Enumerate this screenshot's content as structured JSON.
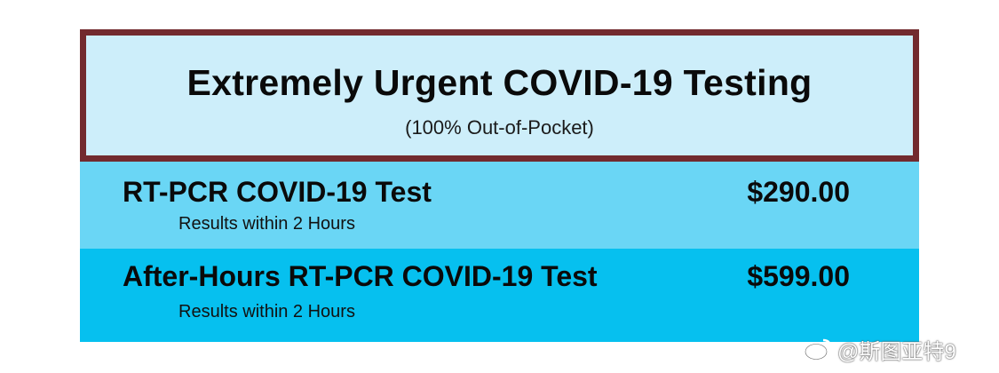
{
  "header": {
    "title": "Extremely Urgent COVID-19 Testing",
    "subtitle": "(100% Out-of-Pocket)"
  },
  "tests": [
    {
      "name": "RT-PCR COVID-19 Test",
      "note": "Results within 2 Hours",
      "price": "$290.00"
    },
    {
      "name": "After-Hours RT-PCR COVID-19 Test",
      "note": "Results within 2 Hours",
      "price": "$599.00"
    }
  ],
  "watermark": {
    "text": "@斯图亚特9",
    "icon": "weibo-icon"
  },
  "colors": {
    "border": "#722a2e",
    "header_bg": "#cdeefa",
    "row1_bg": "#6ad6f5",
    "row2_bg": "#06c0ef"
  }
}
